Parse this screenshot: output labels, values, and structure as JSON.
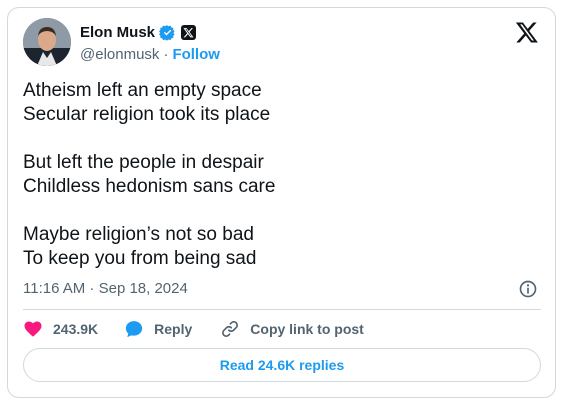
{
  "author": {
    "name": "Elon Musk",
    "handle": "@elonmusk",
    "separator": "·",
    "follow_label": "Follow"
  },
  "tweet": {
    "lines": [
      "Atheism left an empty space",
      "Secular religion took its place",
      "",
      "But left the people in despair",
      "Childless hedonism sans care",
      "",
      "Maybe religion’s not so bad",
      "To keep you from being sad"
    ],
    "timestamp": "11:16 AM · Sep 18, 2024"
  },
  "actions": {
    "like_count": "243.9K",
    "reply_label": "Reply",
    "copy_link_label": "Copy link to post"
  },
  "read_replies_label": "Read 24.6K replies",
  "icons": {
    "verified": "verified-badge-icon",
    "affiliate": "x-logo-badge-icon",
    "close": "x-logo-icon",
    "info": "info-icon",
    "like": "heart-icon",
    "reply": "chat-bubble-icon",
    "copy_link": "link-icon"
  },
  "colors": {
    "accent": "#1d9bf0",
    "like": "#f91880",
    "text": "#0f1419",
    "secondary_text": "#536471",
    "border": "#cfd9de"
  }
}
